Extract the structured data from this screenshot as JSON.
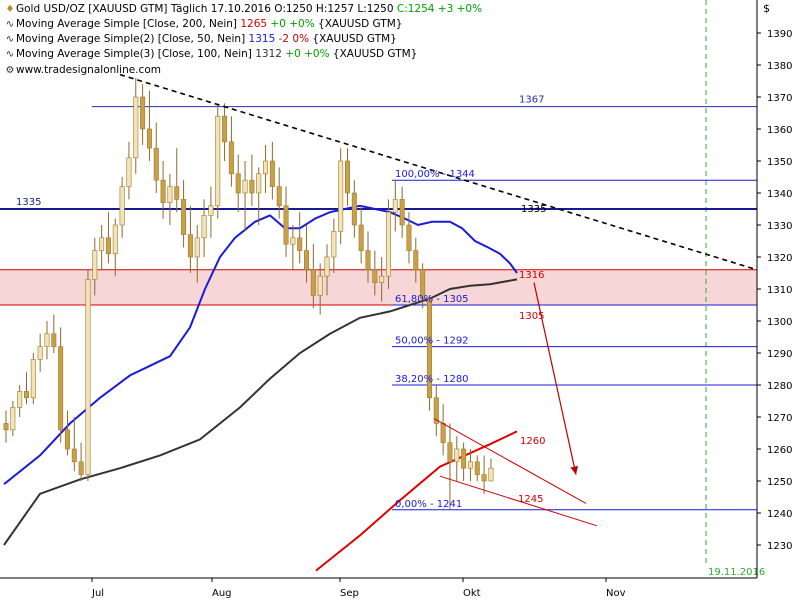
{
  "header": {
    "symbol_name": "Gold USD/OZ [XAUUSD GTM]",
    "timeframe": "Täglich",
    "date": "17.10.2016",
    "open": "O:1250",
    "high": "H:1257",
    "low": "L:1250",
    "close": "C:1254 +3 +0%"
  },
  "legend": [
    {
      "name": "Moving Average Simple [Close, 200, Nein]",
      "value": "1265",
      "change": "+0 +0%",
      "instrument": "{XAUUSD GTM}",
      "color": "#d00000",
      "change_color": "#00a000"
    },
    {
      "name": "Moving Average Simple(2) [Close, 50, Nein]",
      "value": "1315",
      "change": "-2 0%",
      "instrument": "{XAUUSD GTM}",
      "color": "#1a1adb",
      "change_color": "#d00000"
    },
    {
      "name": "Moving Average Simple(3) [Close, 100, Nein]",
      "value": "1312",
      "change": "+0 +0%",
      "instrument": "{XAUUSD GTM}",
      "color": "#333333",
      "change_color": "#00a000"
    }
  ],
  "watermark": "www.tradesignalonline.com",
  "currency_symbol": "$",
  "chart_data": {
    "type": "candlestick",
    "y_axis": {
      "min": 1222,
      "max": 1398,
      "ticks": [
        1230,
        1240,
        1250,
        1260,
        1270,
        1280,
        1290,
        1300,
        1310,
        1320,
        1330,
        1340,
        1350,
        1360,
        1370,
        1380,
        1390
      ]
    },
    "x_axis_labels": [
      {
        "label": "Jul",
        "x": 92
      },
      {
        "label": "Aug",
        "x": 212
      },
      {
        "label": "Sep",
        "x": 340
      },
      {
        "label": "Okt",
        "x": 463
      },
      {
        "label": "Nov",
        "x": 606
      }
    ],
    "date_marker": {
      "label": "19.11.2016",
      "color": "#33aa33"
    },
    "horizontal_levels": [
      {
        "value": 1367,
        "label": "1367",
        "color": "#2a2ab8"
      },
      {
        "value": 1335,
        "label": "1335",
        "color": "#1a1a90"
      },
      {
        "value": 1335,
        "label": "1335",
        "color": "#000000"
      },
      {
        "value": 1316,
        "label": "1316",
        "color": "#d00000"
      },
      {
        "value": 1305,
        "label": "1305",
        "color": "#d00000"
      },
      {
        "value": 1260,
        "label": "1260",
        "color": "#d00000"
      },
      {
        "value": 1245,
        "label": "1245",
        "color": "#d00000"
      }
    ],
    "fibonacci": [
      {
        "label": "100,00% - 1344",
        "value": 1344
      },
      {
        "label": "61,80% - 1305",
        "value": 1305
      },
      {
        "label": "50,00% - 1292",
        "value": 1292
      },
      {
        "label": "38,20% - 1280",
        "value": 1280
      },
      {
        "label": "0,00% - 1241",
        "value": 1241
      }
    ],
    "resistance_zone": {
      "top": 1316,
      "bottom": 1305,
      "color": "#f6d6d6"
    },
    "downtrend_line": {
      "from": {
        "x_index": 46,
        "value": 1377
      },
      "to": {
        "x_index": 284,
        "value": 1316
      },
      "style": "dashed",
      "color": "#000000"
    },
    "channel_lines": [
      {
        "from": [
          434,
          1269.5
        ],
        "to": [
          586,
          1243
        ],
        "color": "#d00000"
      },
      {
        "from": [
          440,
          1251.5
        ],
        "to": [
          597,
          1236
        ],
        "color": "#d00000"
      }
    ],
    "forecast_arrow": {
      "from": [
        534,
        1312
      ],
      "to": [
        576,
        1252
      ],
      "color": "#c00000"
    },
    "series": [
      {
        "name": "Moving Average Simple [Close, 200, Nein]",
        "color": "#e00000",
        "points": [
          [
            316,
            1222
          ],
          [
            360,
            1233
          ],
          [
            400,
            1244
          ],
          [
            440,
            1254.5
          ],
          [
            465,
            1258
          ],
          [
            490,
            1261.5
          ],
          [
            517,
            1265.5
          ]
        ]
      },
      {
        "name": "Moving Average Simple(2) [Close, 50, Nein]",
        "color": "#1a1adb",
        "points": [
          [
            4,
            1249
          ],
          [
            40,
            1258
          ],
          [
            70,
            1268
          ],
          [
            100,
            1276
          ],
          [
            130,
            1283
          ],
          [
            150,
            1286
          ],
          [
            170,
            1289
          ],
          [
            190,
            1298
          ],
          [
            205,
            1310
          ],
          [
            220,
            1320
          ],
          [
            235,
            1326
          ],
          [
            255,
            1331
          ],
          [
            270,
            1333
          ],
          [
            285,
            1329
          ],
          [
            300,
            1329
          ],
          [
            315,
            1332
          ],
          [
            330,
            1334
          ],
          [
            345,
            1335
          ],
          [
            360,
            1336
          ],
          [
            375,
            1335
          ],
          [
            390,
            1334
          ],
          [
            405,
            1332
          ],
          [
            418,
            1330
          ],
          [
            432,
            1331
          ],
          [
            450,
            1331
          ],
          [
            462,
            1329
          ],
          [
            475,
            1325
          ],
          [
            488,
            1323
          ],
          [
            500,
            1321
          ],
          [
            510,
            1318
          ],
          [
            517,
            1315
          ]
        ]
      },
      {
        "name": "Moving Average Simple(3) [Close, 100, Nein]",
        "color": "#333333",
        "points": [
          [
            4,
            1230
          ],
          [
            40,
            1246
          ],
          [
            80,
            1250.5
          ],
          [
            120,
            1254
          ],
          [
            160,
            1258
          ],
          [
            200,
            1263
          ],
          [
            240,
            1273
          ],
          [
            270,
            1282
          ],
          [
            300,
            1290
          ],
          [
            330,
            1296
          ],
          [
            360,
            1301
          ],
          [
            390,
            1303
          ],
          [
            410,
            1305
          ],
          [
            430,
            1307
          ],
          [
            450,
            1310
          ],
          [
            470,
            1311
          ],
          [
            490,
            1311.5
          ],
          [
            517,
            1313
          ]
        ]
      }
    ],
    "candles_ohlc": [
      [
        1268,
        1272,
        1262,
        1266
      ],
      [
        1266,
        1275,
        1264,
        1273
      ],
      [
        1273,
        1280,
        1270,
        1278
      ],
      [
        1278,
        1284,
        1274,
        1276
      ],
      [
        1276,
        1290,
        1274,
        1288
      ],
      [
        1288,
        1296,
        1284,
        1292
      ],
      [
        1292,
        1300,
        1288,
        1296
      ],
      [
        1296,
        1302,
        1290,
        1292
      ],
      [
        1292,
        1298,
        1262,
        1266
      ],
      [
        1266,
        1272,
        1258,
        1260
      ],
      [
        1260,
        1270,
        1253,
        1256
      ],
      [
        1256,
        1262,
        1250,
        1252
      ],
      [
        1252,
        1316,
        1250,
        1313
      ],
      [
        1313,
        1326,
        1308,
        1322
      ],
      [
        1322,
        1330,
        1316,
        1326
      ],
      [
        1326,
        1334,
        1318,
        1321
      ],
      [
        1321,
        1332,
        1314,
        1330
      ],
      [
        1330,
        1345,
        1326,
        1342
      ],
      [
        1342,
        1356,
        1338,
        1351
      ],
      [
        1351,
        1376,
        1346,
        1370
      ],
      [
        1370,
        1374,
        1355,
        1360
      ],
      [
        1360,
        1372,
        1350,
        1354
      ],
      [
        1354,
        1362,
        1340,
        1344
      ],
      [
        1344,
        1350,
        1332,
        1337
      ],
      [
        1337,
        1346,
        1330,
        1342
      ],
      [
        1342,
        1354,
        1334,
        1338
      ],
      [
        1338,
        1344,
        1323,
        1327
      ],
      [
        1327,
        1336,
        1315,
        1320
      ],
      [
        1320,
        1330,
        1312,
        1326
      ],
      [
        1326,
        1338,
        1320,
        1333
      ],
      [
        1333,
        1342,
        1326,
        1336
      ],
      [
        1336,
        1368,
        1332,
        1364
      ],
      [
        1364,
        1368,
        1350,
        1356
      ],
      [
        1356,
        1364,
        1342,
        1346
      ],
      [
        1346,
        1352,
        1334,
        1340
      ],
      [
        1340,
        1350,
        1328,
        1344
      ],
      [
        1344,
        1352,
        1336,
        1340
      ],
      [
        1340,
        1348,
        1330,
        1346
      ],
      [
        1346,
        1355,
        1340,
        1350
      ],
      [
        1350,
        1356,
        1338,
        1342
      ],
      [
        1342,
        1348,
        1332,
        1336
      ],
      [
        1336,
        1342,
        1320,
        1324
      ],
      [
        1324,
        1330,
        1316,
        1326
      ],
      [
        1326,
        1334,
        1318,
        1322
      ],
      [
        1322,
        1330,
        1312,
        1316
      ],
      [
        1316,
        1324,
        1304,
        1308
      ],
      [
        1308,
        1318,
        1302,
        1314
      ],
      [
        1314,
        1324,
        1308,
        1320
      ],
      [
        1320,
        1332,
        1315,
        1328
      ],
      [
        1328,
        1354,
        1324,
        1350
      ],
      [
        1350,
        1354,
        1336,
        1340
      ],
      [
        1340,
        1344,
        1326,
        1330
      ],
      [
        1330,
        1336,
        1318,
        1322
      ],
      [
        1322,
        1328,
        1312,
        1316
      ],
      [
        1316,
        1322,
        1308,
        1312
      ],
      [
        1312,
        1320,
        1306,
        1314
      ],
      [
        1314,
        1338,
        1310,
        1334
      ],
      [
        1334,
        1344,
        1328,
        1338
      ],
      [
        1338,
        1342,
        1326,
        1330
      ],
      [
        1330,
        1334,
        1318,
        1322
      ],
      [
        1322,
        1326,
        1312,
        1316
      ],
      [
        1316,
        1318,
        1304,
        1307
      ],
      [
        1307,
        1308,
        1272,
        1276
      ],
      [
        1276,
        1280,
        1264,
        1268
      ],
      [
        1268,
        1274,
        1258,
        1262
      ],
      [
        1262,
        1268,
        1241,
        1256
      ],
      [
        1256,
        1264,
        1250,
        1260
      ],
      [
        1260,
        1262,
        1250,
        1254
      ],
      [
        1254,
        1260,
        1250,
        1256
      ],
      [
        1256,
        1258,
        1250,
        1252
      ],
      [
        1252,
        1258,
        1246,
        1250
      ],
      [
        1250,
        1257,
        1250,
        1254
      ]
    ]
  }
}
